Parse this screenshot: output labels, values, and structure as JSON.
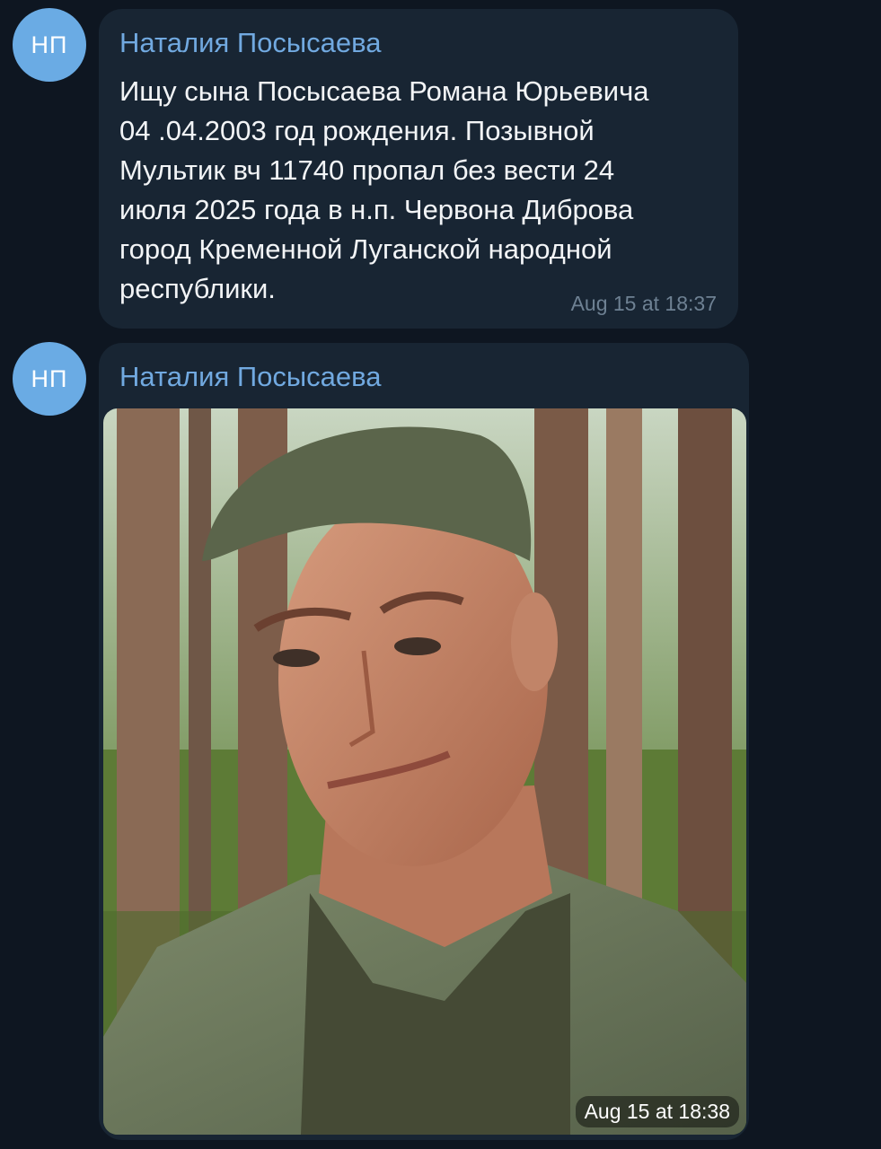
{
  "messages": [
    {
      "avatar_initials": "НП",
      "sender": "Наталия Посысаева",
      "text": "Ищу сына Посысаева Романа Юрьевича\n04 .04.2003 год рождения. Позывной\nМультик вч 11740 пропал без вести 24\nиюля 2025 года в н.п. Червона Диброва\nгород Кременной Луганской народной\nреспублики.",
      "time": "Aug 15 at 18:37"
    },
    {
      "avatar_initials": "НП",
      "sender": "Наталия Посысаева",
      "time": "Aug 15 at 18:38"
    }
  ],
  "colors": {
    "background": "#0e1621",
    "bubble": "#182533",
    "sender_name": "#71a9e0",
    "avatar": "#6aabe4",
    "timestamp": "#6e8193"
  }
}
